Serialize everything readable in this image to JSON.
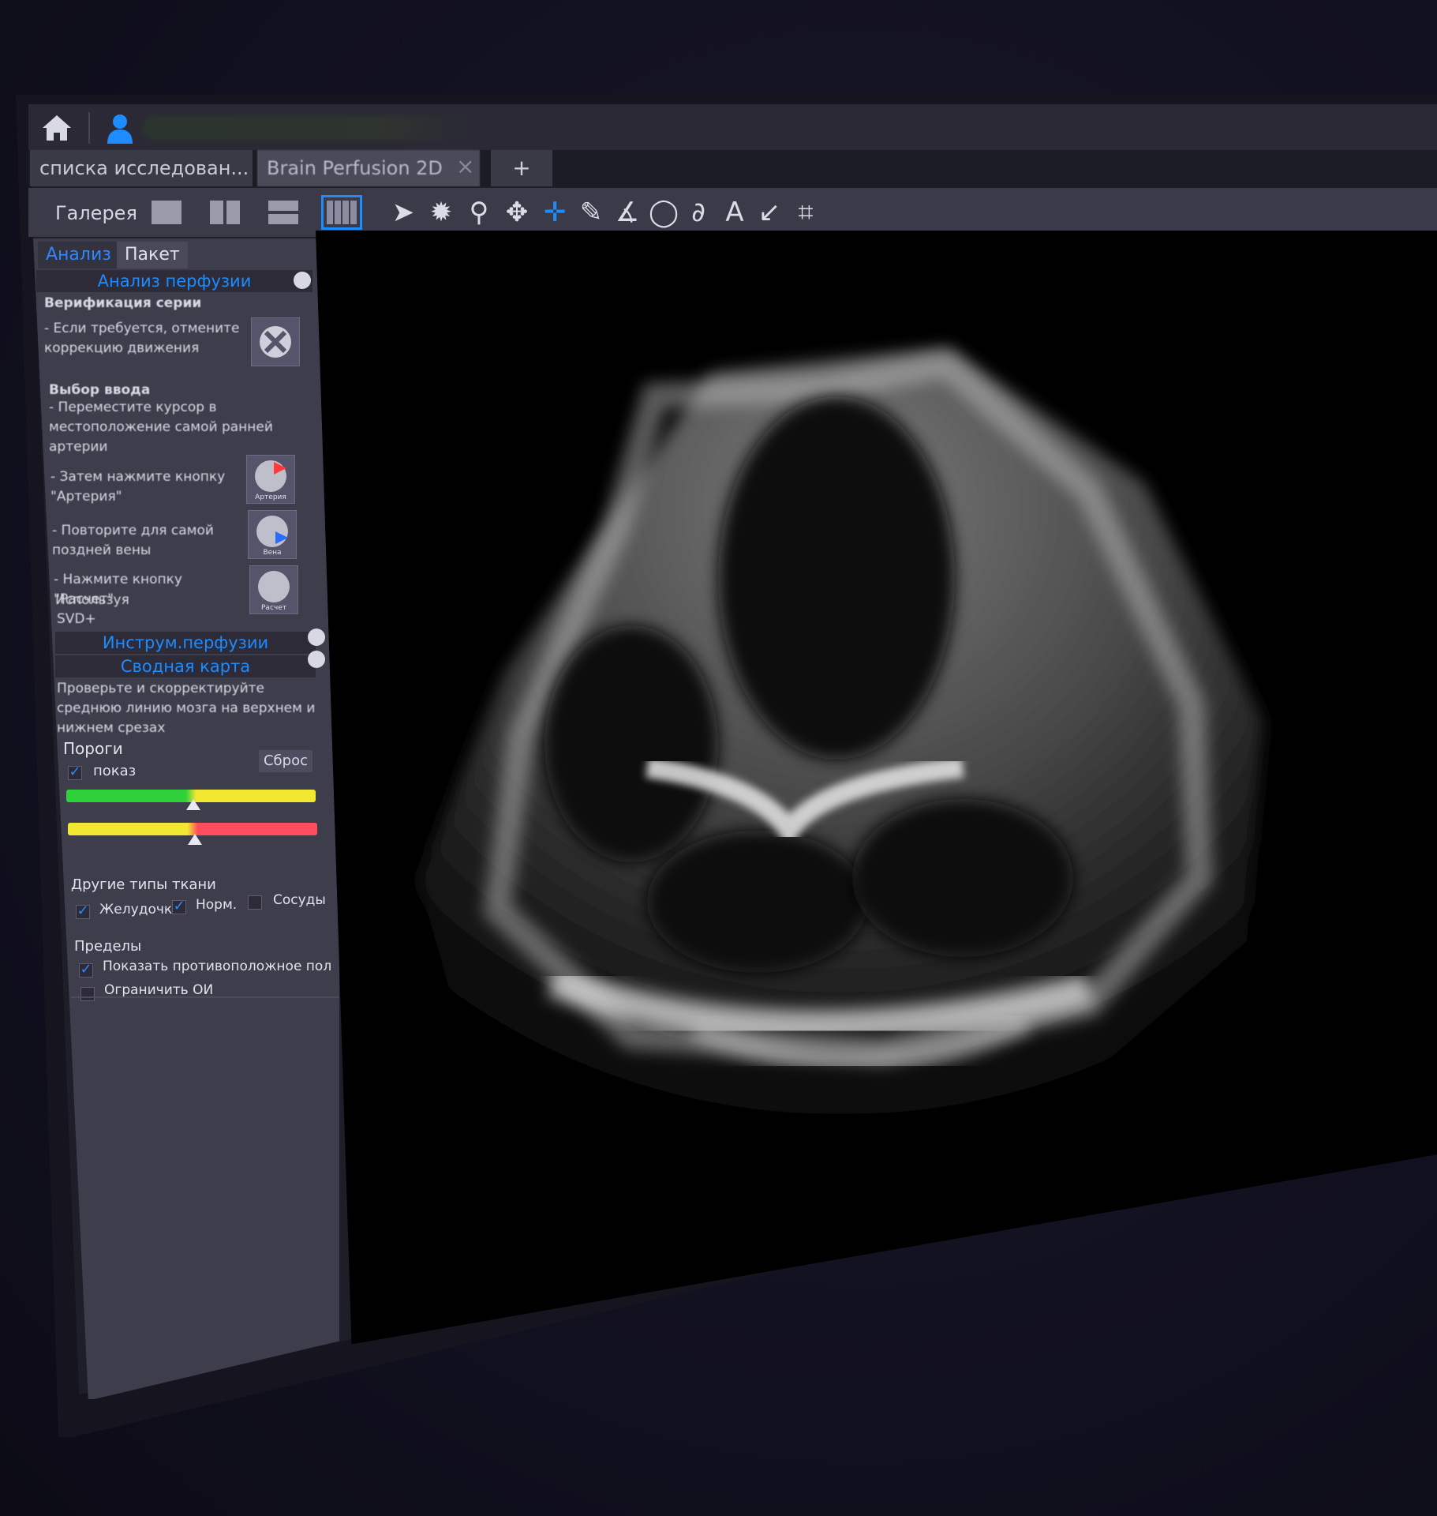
{
  "tabs": [
    {
      "label": "списка исследован..."
    },
    {
      "label": "Brain Perfusion 2D"
    }
  ],
  "tab_add": "+",
  "tab_close": "×",
  "toolbar": {
    "gallery_label": "Галерея",
    "tools": [
      "select-arrow",
      "brightness",
      "zoom",
      "pan",
      "crosshair",
      "ruler",
      "angle",
      "ellipse",
      "freehand",
      "text",
      "arrow",
      "crop"
    ]
  },
  "panel": {
    "tabs": {
      "analysis": "Анализ",
      "batch": "Пакет"
    },
    "sections": {
      "perfusion_analysis": "Анализ перфузии",
      "perfusion_tools": "Инструм.перфузии",
      "summary_map": "Сводная карта"
    },
    "steps": {
      "series_verification": "Верификация серии",
      "motion_hint": "- Если требуется, отмените коррекцию движения",
      "input_choice": "Выбор ввода",
      "move_cursor": "- Переместите курсор в местоположение самой ранней артерии",
      "artery_btn_hint": "- Затем нажмите кнопку \"Артерия\"",
      "vein_hint": "- Повторите для самой поздней вены",
      "calc_hint": "- Нажмите кнопку \"Расчет\"",
      "using": "Используя",
      "svd": "SVD+",
      "midline_hint": "Проверьте и скорректируйте среднюю линию мозга на верхнем и нижнем срезах"
    },
    "buttons": {
      "artery": "Артерия",
      "vein": "Вена",
      "calc": "Расчет"
    },
    "thresholds": {
      "title": "Пороги",
      "show_label": "показ",
      "reset_label": "Сброс",
      "show_checked": true,
      "bar1_green_fraction": 0.5,
      "bar2_yellow_fraction": 0.5
    },
    "tissue_types": {
      "title": "Другие типы ткани",
      "ventricles": {
        "label": "Желудочк",
        "checked": true
      },
      "normal": {
        "label": "Норм.",
        "checked": true
      },
      "vessels": {
        "label": "Сосуды",
        "checked": false
      }
    },
    "limits": {
      "title": "Пределы",
      "show_opposite": {
        "label": "Показать противоположное полу",
        "checked": true
      },
      "limit_roi": {
        "label": "Ограничить ОИ",
        "checked": false
      }
    }
  },
  "colors": {
    "accent": "#1e8bff",
    "green": "#2fd13a",
    "yellow": "#f2e832",
    "red": "#ff4d5e"
  }
}
